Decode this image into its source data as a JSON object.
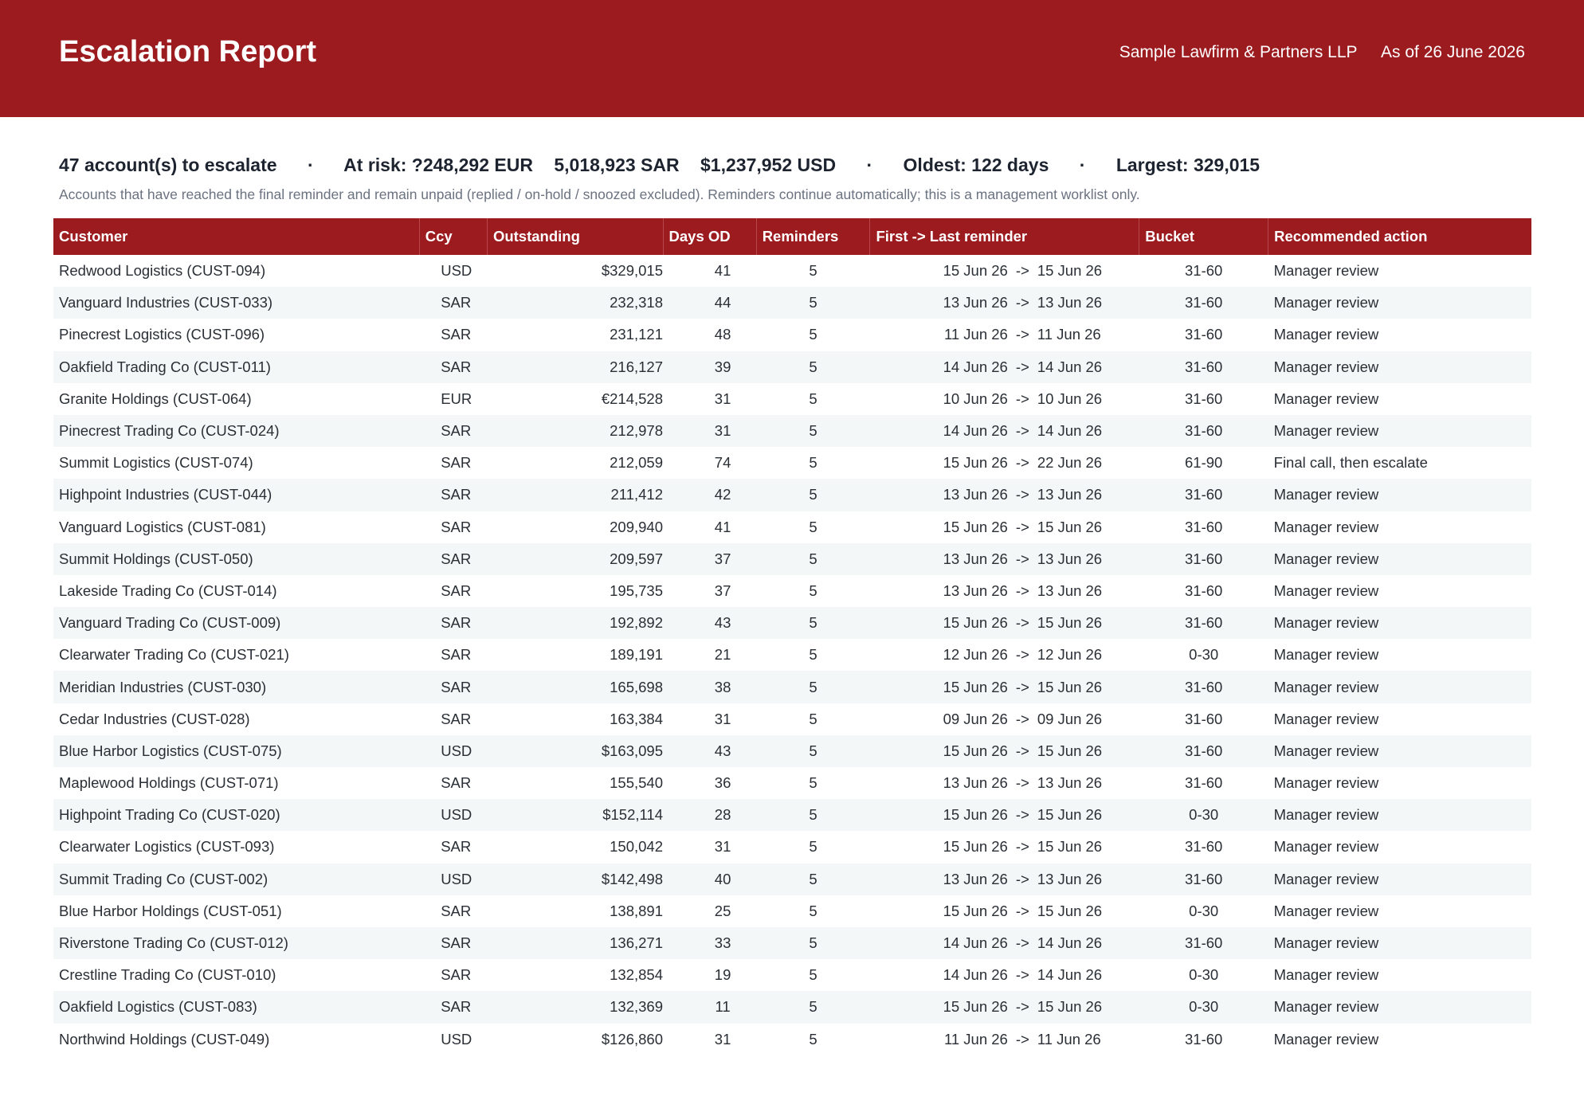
{
  "header": {
    "title": "Escalation Report",
    "firm": "Sample Lawfirm & Partners LLP",
    "as_of": "As of 26 June 2026"
  },
  "summary": {
    "accounts": "47 account(s) to escalate",
    "separator": "·",
    "at_risk_eur": "At risk: ?248,292 EUR",
    "at_risk_sar": "5,018,923 SAR",
    "at_risk_usd": "$1,237,952 USD",
    "oldest": "Oldest: 122 days",
    "largest": "Largest: 329,015",
    "note": "Accounts that have reached the final reminder and remain unpaid (replied / on-hold / snoozed excluded). Reminders continue automatically; this is a management worklist only."
  },
  "table": {
    "arrow": "->",
    "headers": {
      "customer": "Customer",
      "ccy": "Ccy",
      "outstanding": "Outstanding",
      "days_od": "Days OD",
      "reminders": "Reminders",
      "range": "First -> Last reminder",
      "bucket": "Bucket",
      "action": "Recommended action"
    },
    "rows": [
      {
        "customer": "Redwood Logistics (CUST-094)",
        "ccy": "USD",
        "outstanding": "$329,015",
        "days": "41",
        "reminders": "5",
        "first": "15 Jun 26",
        "last": "15 Jun 26",
        "bucket": "31-60",
        "action": "Manager review"
      },
      {
        "customer": "Vanguard Industries (CUST-033)",
        "ccy": "SAR",
        "outstanding": "232,318",
        "days": "44",
        "reminders": "5",
        "first": "13 Jun 26",
        "last": "13 Jun 26",
        "bucket": "31-60",
        "action": "Manager review"
      },
      {
        "customer": "Pinecrest Logistics (CUST-096)",
        "ccy": "SAR",
        "outstanding": "231,121",
        "days": "48",
        "reminders": "5",
        "first": "11 Jun 26",
        "last": "11 Jun 26",
        "bucket": "31-60",
        "action": "Manager review"
      },
      {
        "customer": "Oakfield Trading Co (CUST-011)",
        "ccy": "SAR",
        "outstanding": "216,127",
        "days": "39",
        "reminders": "5",
        "first": "14 Jun 26",
        "last": "14 Jun 26",
        "bucket": "31-60",
        "action": "Manager review"
      },
      {
        "customer": "Granite Holdings (CUST-064)",
        "ccy": "EUR",
        "outstanding": "€214,528",
        "days": "31",
        "reminders": "5",
        "first": "10 Jun 26",
        "last": "10 Jun 26",
        "bucket": "31-60",
        "action": "Manager review"
      },
      {
        "customer": "Pinecrest Trading Co (CUST-024)",
        "ccy": "SAR",
        "outstanding": "212,978",
        "days": "31",
        "reminders": "5",
        "first": "14 Jun 26",
        "last": "14 Jun 26",
        "bucket": "31-60",
        "action": "Manager review"
      },
      {
        "customer": "Summit Logistics (CUST-074)",
        "ccy": "SAR",
        "outstanding": "212,059",
        "days": "74",
        "reminders": "5",
        "first": "15 Jun 26",
        "last": "22 Jun 26",
        "bucket": "61-90",
        "action": "Final call, then escalate"
      },
      {
        "customer": "Highpoint Industries (CUST-044)",
        "ccy": "SAR",
        "outstanding": "211,412",
        "days": "42",
        "reminders": "5",
        "first": "13 Jun 26",
        "last": "13 Jun 26",
        "bucket": "31-60",
        "action": "Manager review"
      },
      {
        "customer": "Vanguard Logistics (CUST-081)",
        "ccy": "SAR",
        "outstanding": "209,940",
        "days": "41",
        "reminders": "5",
        "first": "15 Jun 26",
        "last": "15 Jun 26",
        "bucket": "31-60",
        "action": "Manager review"
      },
      {
        "customer": "Summit Holdings (CUST-050)",
        "ccy": "SAR",
        "outstanding": "209,597",
        "days": "37",
        "reminders": "5",
        "first": "13 Jun 26",
        "last": "13 Jun 26",
        "bucket": "31-60",
        "action": "Manager review"
      },
      {
        "customer": "Lakeside Trading Co (CUST-014)",
        "ccy": "SAR",
        "outstanding": "195,735",
        "days": "37",
        "reminders": "5",
        "first": "13 Jun 26",
        "last": "13 Jun 26",
        "bucket": "31-60",
        "action": "Manager review"
      },
      {
        "customer": "Vanguard Trading Co (CUST-009)",
        "ccy": "SAR",
        "outstanding": "192,892",
        "days": "43",
        "reminders": "5",
        "first": "15 Jun 26",
        "last": "15 Jun 26",
        "bucket": "31-60",
        "action": "Manager review"
      },
      {
        "customer": "Clearwater Trading Co (CUST-021)",
        "ccy": "SAR",
        "outstanding": "189,191",
        "days": "21",
        "reminders": "5",
        "first": "12 Jun 26",
        "last": "12 Jun 26",
        "bucket": "0-30",
        "action": "Manager review"
      },
      {
        "customer": "Meridian Industries (CUST-030)",
        "ccy": "SAR",
        "outstanding": "165,698",
        "days": "38",
        "reminders": "5",
        "first": "15 Jun 26",
        "last": "15 Jun 26",
        "bucket": "31-60",
        "action": "Manager review"
      },
      {
        "customer": "Cedar Industries (CUST-028)",
        "ccy": "SAR",
        "outstanding": "163,384",
        "days": "31",
        "reminders": "5",
        "first": "09 Jun 26",
        "last": "09 Jun 26",
        "bucket": "31-60",
        "action": "Manager review"
      },
      {
        "customer": "Blue Harbor Logistics (CUST-075)",
        "ccy": "USD",
        "outstanding": "$163,095",
        "days": "43",
        "reminders": "5",
        "first": "15 Jun 26",
        "last": "15 Jun 26",
        "bucket": "31-60",
        "action": "Manager review"
      },
      {
        "customer": "Maplewood Holdings (CUST-071)",
        "ccy": "SAR",
        "outstanding": "155,540",
        "days": "36",
        "reminders": "5",
        "first": "13 Jun 26",
        "last": "13 Jun 26",
        "bucket": "31-60",
        "action": "Manager review"
      },
      {
        "customer": "Highpoint Trading Co (CUST-020)",
        "ccy": "USD",
        "outstanding": "$152,114",
        "days": "28",
        "reminders": "5",
        "first": "15 Jun 26",
        "last": "15 Jun 26",
        "bucket": "0-30",
        "action": "Manager review"
      },
      {
        "customer": "Clearwater Logistics (CUST-093)",
        "ccy": "SAR",
        "outstanding": "150,042",
        "days": "31",
        "reminders": "5",
        "first": "15 Jun 26",
        "last": "15 Jun 26",
        "bucket": "31-60",
        "action": "Manager review"
      },
      {
        "customer": "Summit Trading Co (CUST-002)",
        "ccy": "USD",
        "outstanding": "$142,498",
        "days": "40",
        "reminders": "5",
        "first": "13 Jun 26",
        "last": "13 Jun 26",
        "bucket": "31-60",
        "action": "Manager review"
      },
      {
        "customer": "Blue Harbor Holdings (CUST-051)",
        "ccy": "SAR",
        "outstanding": "138,891",
        "days": "25",
        "reminders": "5",
        "first": "15 Jun 26",
        "last": "15 Jun 26",
        "bucket": "0-30",
        "action": "Manager review"
      },
      {
        "customer": "Riverstone Trading Co (CUST-012)",
        "ccy": "SAR",
        "outstanding": "136,271",
        "days": "33",
        "reminders": "5",
        "first": "14 Jun 26",
        "last": "14 Jun 26",
        "bucket": "31-60",
        "action": "Manager review"
      },
      {
        "customer": "Crestline Trading Co (CUST-010)",
        "ccy": "SAR",
        "outstanding": "132,854",
        "days": "19",
        "reminders": "5",
        "first": "14 Jun 26",
        "last": "14 Jun 26",
        "bucket": "0-30",
        "action": "Manager review"
      },
      {
        "customer": "Oakfield Logistics (CUST-083)",
        "ccy": "SAR",
        "outstanding": "132,369",
        "days": "11",
        "reminders": "5",
        "first": "15 Jun 26",
        "last": "15 Jun 26",
        "bucket": "0-30",
        "action": "Manager review"
      },
      {
        "customer": "Northwind Holdings (CUST-049)",
        "ccy": "USD",
        "outstanding": "$126,860",
        "days": "31",
        "reminders": "5",
        "first": "11 Jun 26",
        "last": "11 Jun 26",
        "bucket": "31-60",
        "action": "Manager review"
      }
    ]
  },
  "colors": {
    "brand": "#9b1b1f",
    "row_alt": "#f4f7f8",
    "note_text": "#6b7280"
  }
}
